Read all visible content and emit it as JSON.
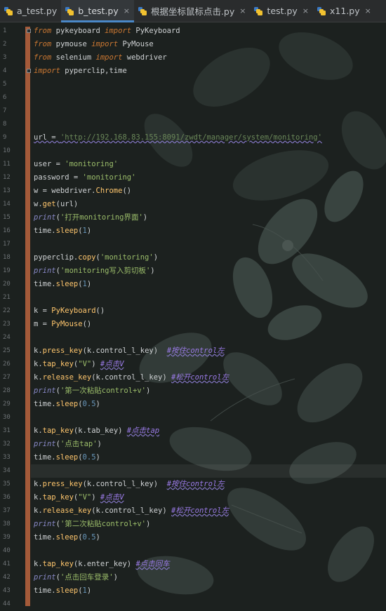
{
  "tabs": [
    {
      "label": "a_test.py",
      "active": false
    },
    {
      "label": "b_test.py",
      "active": true
    },
    {
      "label": "根据坐标鼠标点击.py",
      "active": false
    },
    {
      "label": "test.py",
      "active": false
    },
    {
      "label": "x11.py",
      "active": false
    }
  ],
  "tab_close_glyph": "×",
  "line_numbers": [
    "1",
    "2",
    "3",
    "4",
    "5",
    "6",
    "7",
    "8",
    "9",
    "10",
    "11",
    "12",
    "13",
    "14",
    "15",
    "16",
    "17",
    "18",
    "19",
    "20",
    "21",
    "22",
    "23",
    "24",
    "25",
    "26",
    "27",
    "28",
    "29",
    "30",
    "31",
    "32",
    "33",
    "34",
    "35",
    "36",
    "37",
    "38",
    "39",
    "40",
    "41",
    "42",
    "43",
    "44"
  ],
  "code": {
    "l1": {
      "kw1": "from",
      "mod": " pykeyboard ",
      "kw2": "import",
      "name": " PyKeyboard"
    },
    "l2": {
      "kw1": "from",
      "mod": " pymouse ",
      "kw2": "import",
      "name": " PyMouse"
    },
    "l3": {
      "kw1": "from",
      "mod": " selenium ",
      "kw2": "import",
      "name": " webdriver"
    },
    "l4": {
      "kw1": "import",
      "name": " pyperclip",
      "sep": ",",
      "name2": "time"
    },
    "l9": {
      "var": "url = ",
      "val": "'http://192.168.83.155:8091/zwdt/manager/system/monitoring'"
    },
    "l11": {
      "var": "user = ",
      "val": "'monitoring'"
    },
    "l12": {
      "var": "password = ",
      "val": "'monitoring'"
    },
    "l13": {
      "pre": "w = webdriver.",
      "fn": "Chrome",
      "post": "()"
    },
    "l14": {
      "pre": "w.",
      "fn": "get",
      "post": "(url)"
    },
    "l15": {
      "fn": "print",
      "open": "(",
      "str": "'打开monitoring界面'",
      "close": ")"
    },
    "l16": {
      "pre": "time.",
      "fn": "sleep",
      "open": "(",
      "num": "1",
      "close": ")"
    },
    "l18": {
      "pre": "pyperclip.",
      "fn": "copy",
      "open": "(",
      "str": "'monitoring'",
      "close": ")"
    },
    "l19": {
      "fn": "print",
      "open": "(",
      "str": "'monitoring写入剪切板'",
      "close": ")"
    },
    "l20": {
      "pre": "time.",
      "fn": "sleep",
      "open": "(",
      "num": "1",
      "close": ")"
    },
    "l22": {
      "pre": "k = ",
      "fn": "PyKeyboard",
      "post": "()"
    },
    "l23": {
      "pre": "m = ",
      "fn": "PyMouse",
      "post": "()"
    },
    "l25": {
      "pre": "k.",
      "fn": "press_key",
      "args": "(k.control_l_key)",
      "gap": "  ",
      "cm": "#按住control左"
    },
    "l26": {
      "pre": "k.",
      "fn": "tap_key",
      "open": "(",
      "str": "\"V\"",
      "close": ")",
      "gap": " ",
      "cm": "#点击V"
    },
    "l27": {
      "pre": "k.",
      "fn": "release_key",
      "args": "(k.control_l_key)",
      "gap": " ",
      "cm": "#松开control左"
    },
    "l28": {
      "fn": "print",
      "open": "(",
      "str": "'第一次粘贴control+v'",
      "close": ")"
    },
    "l29": {
      "pre": "time.",
      "fn": "sleep",
      "open": "(",
      "num": "0.5",
      "close": ")"
    },
    "l31": {
      "pre": "k.",
      "fn": "tap_key",
      "args": "(k.tab_key)",
      "gap": " ",
      "cm": "#点击tap"
    },
    "l32": {
      "fn": "print",
      "open": "(",
      "str": "'点击tap'",
      "close": ")"
    },
    "l33": {
      "pre": "time.",
      "fn": "sleep",
      "open": "(",
      "num": "0.5",
      "close": ")"
    },
    "l35": {
      "pre": "k.",
      "fn": "press_key",
      "args": "(k.control_l_key)",
      "gap": "  ",
      "cm": "#按住control左"
    },
    "l36": {
      "pre": "k.",
      "fn": "tap_key",
      "open": "(",
      "str": "\"V\"",
      "close": ")",
      "gap": " ",
      "cm": "#点击V"
    },
    "l37": {
      "pre": "k.",
      "fn": "release_key",
      "args": "(k.control_l_key)",
      "gap": " ",
      "cm": "#松开control左"
    },
    "l38": {
      "fn": "print",
      "open": "(",
      "str": "'第二次粘贴control+v'",
      "close": ")"
    },
    "l39": {
      "pre": "time.",
      "fn": "sleep",
      "open": "(",
      "num": "0.5",
      "close": ")"
    },
    "l41": {
      "pre": "k.",
      "fn": "tap_key",
      "args": "(k.enter_key)",
      "gap": " ",
      "cm": "#点击回车"
    },
    "l42": {
      "fn": "print",
      "open": "(",
      "str": "'点击回车登录'",
      "close": ")"
    },
    "l43": {
      "pre": "time.",
      "fn": "sleep",
      "open": "(",
      "num": "1",
      "close": ")"
    }
  },
  "colors": {
    "keyword": "#cc7832",
    "string": "#9bbd6a",
    "function": "#ffc66d",
    "builtin": "#8888c6",
    "number": "#6897bb",
    "comment": "#9b7be8",
    "change_marker": "#a45a39",
    "active_tab_underline": "#4a88c7"
  }
}
